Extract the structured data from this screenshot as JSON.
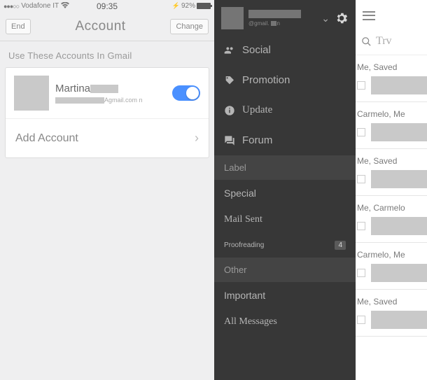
{
  "panel1": {
    "status": {
      "carrier": "Vodafone IT",
      "time": "09:35",
      "battery": "92%"
    },
    "nav": {
      "left": "End",
      "title": "Account",
      "right": "Change"
    },
    "section_header": "Use These Accounts In Gmail",
    "account": {
      "name": "Martina",
      "email_suffix": "Agmail.com n"
    },
    "add_account": "Add Account"
  },
  "panel2": {
    "user": {
      "email_prefix": "@gmail.",
      "email_suffix": "n"
    },
    "categories": {
      "social": "Social",
      "promotion": "Promotion",
      "update": "Update",
      "forum": "Forum"
    },
    "sections": {
      "label": "Label",
      "other": "Other"
    },
    "labels": {
      "special": "Special",
      "mail_sent": "Mail Sent",
      "proofreading": "Proofreading",
      "proofreading_count": "4",
      "important": "Important",
      "all_messages": "All Messages"
    }
  },
  "panel3": {
    "search_placeholder": "Trv",
    "mails": [
      {
        "sender": "Me, Saved"
      },
      {
        "sender": "Carmelo, Me"
      },
      {
        "sender": "Me, Saved"
      },
      {
        "sender": "Me, Carmelo"
      },
      {
        "sender": "Carmelo, Me"
      },
      {
        "sender": "Me, Saved"
      }
    ]
  }
}
